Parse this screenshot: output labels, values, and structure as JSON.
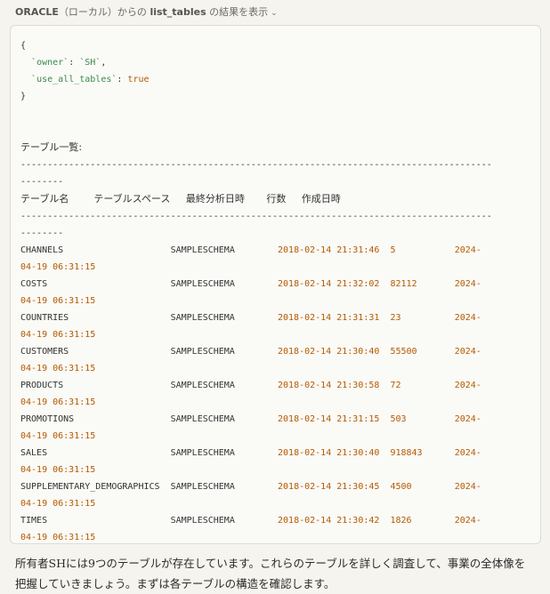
{
  "header": {
    "source": "ORACLE",
    "source_note": "（ローカル）からの",
    "tool_name": "list_tables",
    "suffix": "の結果を表示"
  },
  "request": {
    "open": "{",
    "lines": [
      {
        "key": "`owner`",
        "value": "`SH`",
        "trail": ","
      },
      {
        "key": "`use_all_tables`",
        "value": "true",
        "trail": ""
      }
    ],
    "close": "}"
  },
  "result": {
    "title": "テーブル一覧:",
    "separator": "-------------------------------------------------------------------------------------------------",
    "columns": [
      "テーブル名",
      "テーブルスペース",
      "最終分析日時",
      "行数",
      "作成日時"
    ],
    "rows": [
      {
        "name": "CHANNELS",
        "tablespace": "SAMPLESCHEMA",
        "analyzed": "2018-02-14 21:31:46",
        "rows": "5",
        "created_a": "2024-",
        "created_b": "04-19 06:31:15"
      },
      {
        "name": "COSTS",
        "tablespace": "SAMPLESCHEMA",
        "analyzed": "2018-02-14 21:32:02",
        "rows": "82112",
        "created_a": "2024-",
        "created_b": "04-19 06:31:15"
      },
      {
        "name": "COUNTRIES",
        "tablespace": "SAMPLESCHEMA",
        "analyzed": "2018-02-14 21:31:31",
        "rows": "23",
        "created_a": "2024-",
        "created_b": "04-19 06:31:15"
      },
      {
        "name": "CUSTOMERS",
        "tablespace": "SAMPLESCHEMA",
        "analyzed": "2018-02-14 21:30:40",
        "rows": "55500",
        "created_a": "2024-",
        "created_b": "04-19 06:31:15"
      },
      {
        "name": "PRODUCTS",
        "tablespace": "SAMPLESCHEMA",
        "analyzed": "2018-02-14 21:30:58",
        "rows": "72",
        "created_a": "2024-",
        "created_b": "04-19 06:31:15"
      },
      {
        "name": "PROMOTIONS",
        "tablespace": "SAMPLESCHEMA",
        "analyzed": "2018-02-14 21:31:15",
        "rows": "503",
        "created_a": "2024-",
        "created_b": "04-19 06:31:15"
      },
      {
        "name": "SALES",
        "tablespace": "SAMPLESCHEMA",
        "analyzed": "2018-02-14 21:30:40",
        "rows": "918843",
        "created_a": "2024-",
        "created_b": "04-19 06:31:15"
      },
      {
        "name": "SUPPLEMENTARY_DEMOGRAPHICS",
        "tablespace": "SAMPLESCHEMA",
        "analyzed": "2018-02-14 21:30:45",
        "rows": "4500",
        "created_a": "2024-",
        "created_b": "04-19 06:31:15"
      },
      {
        "name": "TIMES",
        "tablespace": "SAMPLESCHEMA",
        "analyzed": "2018-02-14 21:30:42",
        "rows": "1826",
        "created_a": "2024-",
        "created_b": "04-19 06:31:15"
      }
    ]
  },
  "footer": {
    "text": "所有者SHには9つのテーブルが存在しています。これらのテーブルを詳しく調査して、事業の全体像を把握していきましょう。まずは各テーブルの構造を確認します。"
  }
}
